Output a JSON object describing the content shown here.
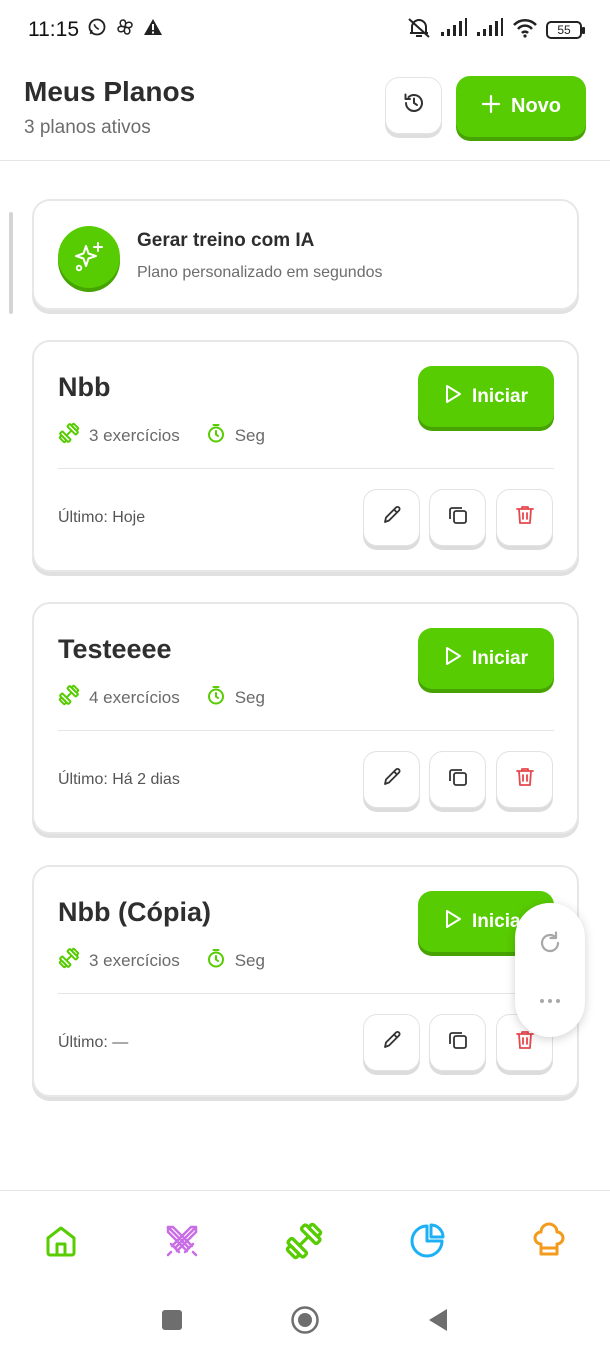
{
  "status_bar": {
    "time": "11:15",
    "battery": "55"
  },
  "header": {
    "title": "Meus Planos",
    "subtitle": "3 planos ativos",
    "new_button_label": "Novo"
  },
  "ai_card": {
    "title": "Gerar treino com IA",
    "subtitle": "Plano personalizado em segundos"
  },
  "plans": [
    {
      "name": "Nbb",
      "exercises": "3 exercícios",
      "days": "Seg",
      "start_label": "Iniciar",
      "last": "Último: Hoje"
    },
    {
      "name": "Testeeee",
      "exercises": "4 exercícios",
      "days": "Seg",
      "start_label": "Iniciar",
      "last": "Último: Há 2 dias"
    },
    {
      "name": "Nbb (Cópia)",
      "exercises": "3 exercícios",
      "days": "Seg",
      "start_label": "Iniciar",
      "last": "Último: —"
    }
  ],
  "colors": {
    "accent": "#58cc02",
    "accent_dark": "#46a302",
    "delete": "#e5484d",
    "nav_home": "#58cc02",
    "nav_battle": "#c86ee6",
    "nav_workout": "#58cc02",
    "nav_stats": "#1cb0f6",
    "nav_chef": "#f29b1c"
  },
  "bottom_nav": {
    "items": [
      "home-icon",
      "crossed-swords-icon",
      "dumbbell-icon",
      "pie-chart-icon",
      "chef-hat-icon"
    ]
  }
}
